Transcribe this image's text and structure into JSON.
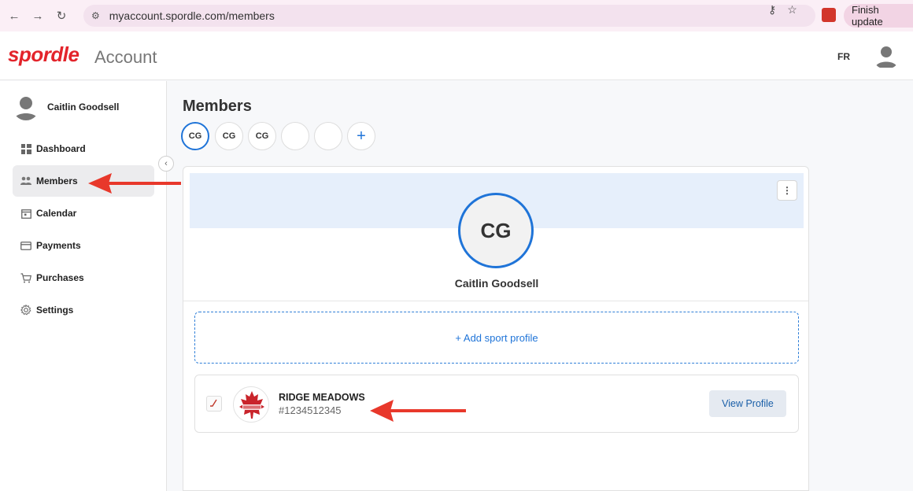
{
  "browser": {
    "url": "myaccount.spordle.com/members",
    "finish_update": "Finish update"
  },
  "header": {
    "logo": "spordle",
    "subtitle": "Account",
    "language": "FR"
  },
  "sidebar": {
    "user_name": "Caitlin Goodsell",
    "items": [
      {
        "label": "Dashboard",
        "icon": "dashboard-icon"
      },
      {
        "label": "Members",
        "icon": "members-icon",
        "active": true
      },
      {
        "label": "Calendar",
        "icon": "calendar-icon"
      },
      {
        "label": "Payments",
        "icon": "payments-icon"
      },
      {
        "label": "Purchases",
        "icon": "cart-icon"
      },
      {
        "label": "Settings",
        "icon": "gear-icon"
      }
    ]
  },
  "main": {
    "title": "Members",
    "chips": [
      "CG",
      "CG",
      "CG",
      "",
      ""
    ],
    "member": {
      "initials": "CG",
      "name": "Caitlin Goodsell"
    },
    "add_profile_label": "+ Add sport profile",
    "profile": {
      "org_name": "RIDGE MEADOWS",
      "member_number": "#1234512345",
      "view_label": "View Profile"
    }
  },
  "colors": {
    "brand_red": "#e3242b",
    "accent_blue": "#1f74d8",
    "banner": "#e6effb",
    "arrow_red": "#e8382b"
  }
}
